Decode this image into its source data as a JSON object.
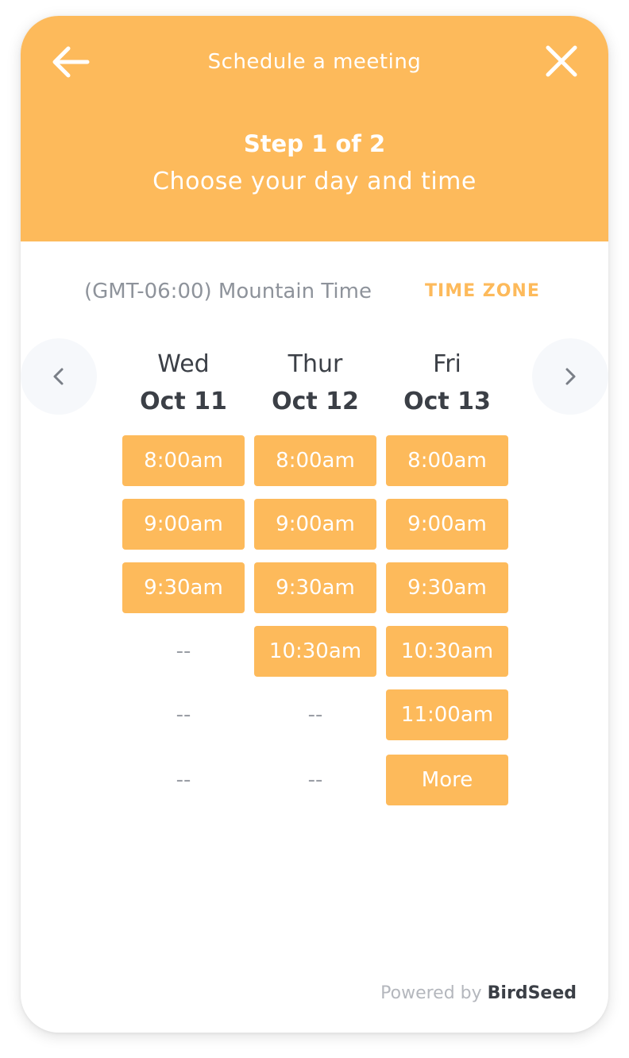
{
  "header": {
    "title": "Schedule a meeting",
    "step": "Step 1 of 2",
    "subtitle": "Choose your day and time",
    "back_icon": "arrow-left-icon",
    "close_icon": "close-icon",
    "background_color": "#FDBA5B"
  },
  "timezone": {
    "label": "(GMT-06:00) Mountain Time",
    "action_label": "TIME ZONE"
  },
  "navigation": {
    "prev_icon": "chevron-left-icon",
    "next_icon": "chevron-right-icon"
  },
  "days": [
    {
      "name": "Wed",
      "date": "Oct 11",
      "slots": [
        "8:00am",
        "9:00am",
        "9:30am",
        "--",
        "--",
        "--"
      ],
      "slot_available": [
        true,
        true,
        true,
        false,
        false,
        false
      ]
    },
    {
      "name": "Thur",
      "date": "Oct 12",
      "slots": [
        "8:00am",
        "9:00am",
        "9:30am",
        "10:30am",
        "--",
        "--"
      ],
      "slot_available": [
        true,
        true,
        true,
        true,
        false,
        false
      ]
    },
    {
      "name": "Fri",
      "date": "Oct 13",
      "slots": [
        "8:00am",
        "9:00am",
        "9:30am",
        "10:30am",
        "11:00am",
        "More"
      ],
      "slot_available": [
        true,
        true,
        true,
        true,
        true,
        true
      ]
    }
  ],
  "footer": {
    "powered_by": "Powered by",
    "brand": "BirdSeed"
  },
  "colors": {
    "accent": "#FDBA5B",
    "text_dark": "#3B3F46",
    "text_muted": "#8E939B"
  }
}
